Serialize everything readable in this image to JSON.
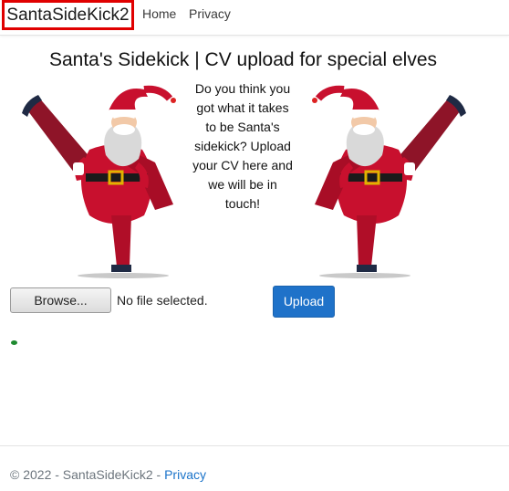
{
  "navbar": {
    "brand": "SantaSideKick2",
    "links": [
      "Home",
      "Privacy"
    ],
    "brand_highlight_color": "#e00000"
  },
  "main": {
    "title": "Santa's Sidekick | CV upload for special elves",
    "blurb": "Do you think you got what it takes to be Santa's sidekick? Upload your CV here and we will be in touch!",
    "images": [
      {
        "icon": "santa-dancing-illustration"
      },
      {
        "icon": "santa-dancing-illustration"
      }
    ]
  },
  "upload": {
    "browse_label": "Browse...",
    "file_status": "No file selected.",
    "upload_label": "Upload",
    "upload_color": "#1f72c9"
  },
  "footer": {
    "copyright": "© 2022 - SantaSideKick2 - ",
    "privacy_link": "Privacy"
  }
}
